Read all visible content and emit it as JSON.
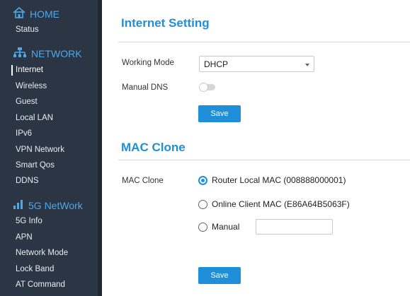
{
  "sidebar": {
    "home": {
      "title": "HOME",
      "items": [
        "Status"
      ]
    },
    "network": {
      "title": "NETWORK",
      "items": [
        "Internet",
        "Wireless",
        "Guest",
        "Local LAN",
        "IPv6",
        "VPN Network",
        "Smart Qos",
        "DDNS"
      ]
    },
    "fiveg": {
      "title": "5G NetWork",
      "items": [
        "5G Info",
        "APN",
        "Network Mode",
        "Lock Band",
        "AT Command"
      ]
    },
    "active_item": "Internet"
  },
  "internet_setting": {
    "title": "Internet Setting",
    "working_mode_label": "Working Mode",
    "working_mode_value": "DHCP",
    "manual_dns_label": "Manual DNS",
    "manual_dns_enabled": false,
    "save_label": "Save"
  },
  "mac_clone": {
    "title": "MAC Clone",
    "label": "MAC Clone",
    "options": [
      {
        "label": "Router Local MAC (008888000001)",
        "checked": true
      },
      {
        "label": "Online Client MAC (E86A64B5063F)",
        "checked": false
      },
      {
        "label": "Manual",
        "checked": false
      }
    ],
    "manual_value": "",
    "save_label": "Save"
  },
  "colors": {
    "accent": "#1e8fd8",
    "sidebar_bg": "#2b3544",
    "sidebar_heading": "#4fa8e8"
  }
}
